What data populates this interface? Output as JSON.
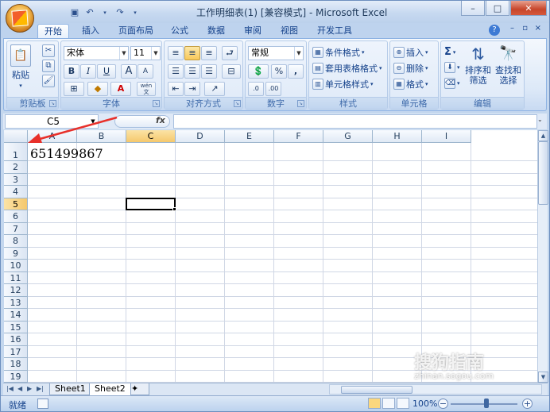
{
  "title": {
    "text": "工作明细表(1)  [兼容模式] - Microsoft Excel"
  },
  "tabs": [
    "开始",
    "插入",
    "页面布局",
    "公式",
    "数据",
    "审阅",
    "视图",
    "开发工具"
  ],
  "ribbon": {
    "clipboard": {
      "label": "剪贴板",
      "paste": "粘贴"
    },
    "font": {
      "label": "字体",
      "name": "宋体",
      "size": "11",
      "bold": "B",
      "italic": "I",
      "underline": "U",
      "grow": "A",
      "shrink": "A",
      "wen": "wén\n文"
    },
    "alignment": {
      "label": "对齐方式"
    },
    "number": {
      "label": "数字",
      "format": "常规",
      "percent": "%",
      "comma": ","
    },
    "styles": {
      "label": "样式",
      "conditional": "条件格式",
      "table": "套用表格格式",
      "cell": "单元格样式"
    },
    "cells": {
      "label": "单元格",
      "insert": "插入",
      "delete": "删除",
      "format": "格式"
    },
    "editing": {
      "label": "编辑",
      "sort": "排序和\n筛选",
      "find": "查找和\n选择",
      "sigma": "Σ"
    }
  },
  "formula_bar": {
    "name_box": "C5",
    "fx": "fx",
    "formula": ""
  },
  "columns": [
    "A",
    "B",
    "C",
    "D",
    "E",
    "F",
    "G",
    "H",
    "I"
  ],
  "rows": [
    "1",
    "2",
    "3",
    "4",
    "5",
    "6",
    "7",
    "8",
    "9",
    "10",
    "11",
    "12",
    "13",
    "14",
    "15",
    "16",
    "17",
    "18",
    "19"
  ],
  "cells": {
    "A1": "651499867"
  },
  "selected_cell": "C5",
  "sheets": [
    "Sheet1",
    "Sheet2"
  ],
  "active_sheet": "Sheet2",
  "status": {
    "ready": "就绪",
    "zoom": "100%"
  },
  "watermark": {
    "text": "搜狗指南",
    "url": "zhinan.sogou.com"
  }
}
